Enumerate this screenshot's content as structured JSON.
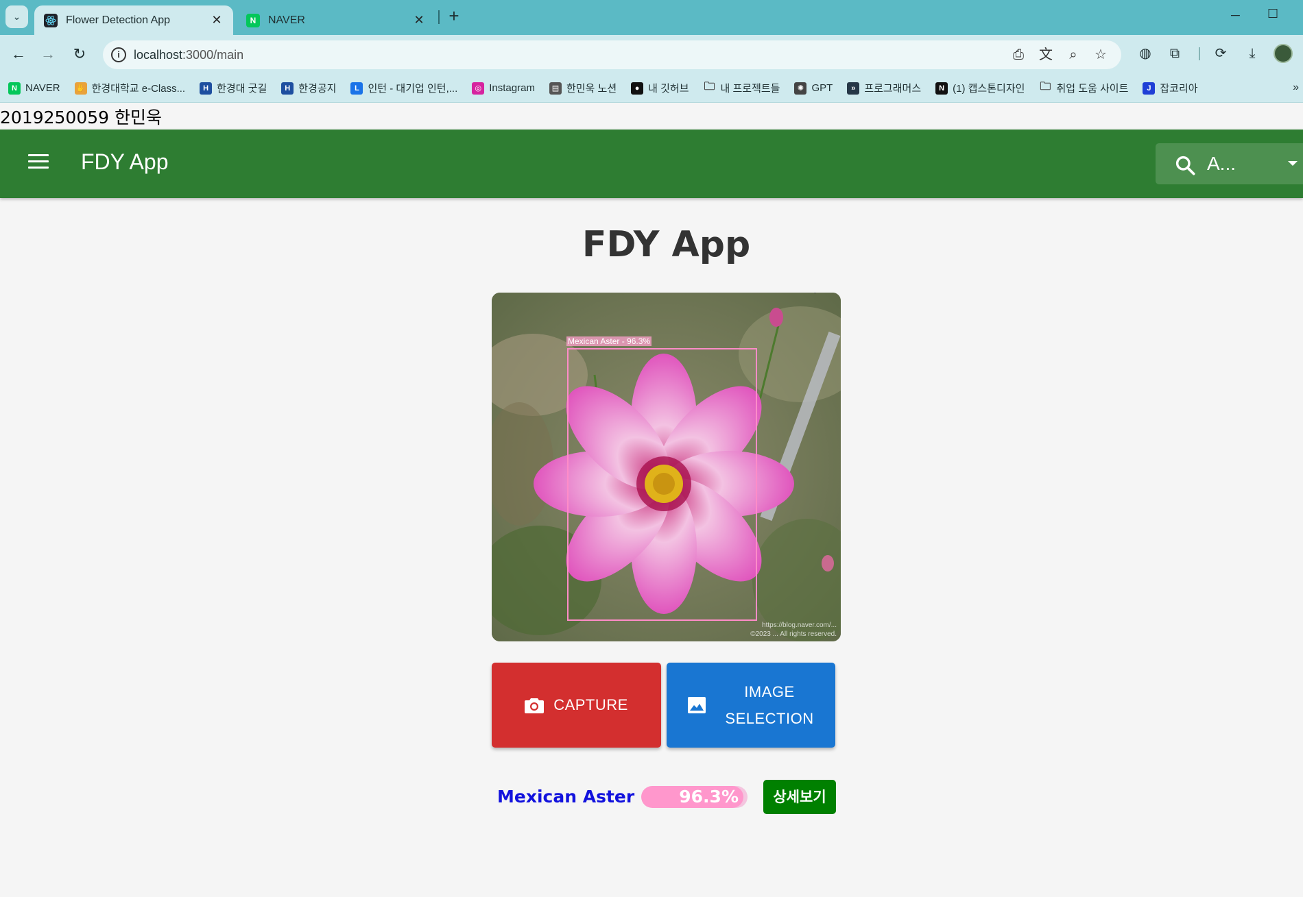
{
  "browser": {
    "tabs": [
      {
        "title": "Flower Detection App",
        "favicon": "react-icon",
        "active": true
      },
      {
        "title": "NAVER",
        "favicon": "naver-icon",
        "active": false
      }
    ],
    "new_tab_label": "+",
    "url_host": "localhost",
    "url_path": ":3000/main",
    "bookmarks": [
      {
        "label": "NAVER",
        "icon": "naver-icon",
        "color": "#03c75a"
      },
      {
        "label": "한경대학교 e-Class...",
        "icon": "hand-icon",
        "color": "#e9a23b"
      },
      {
        "label": "한경대 굿길",
        "icon": "hk-icon",
        "color": "#1e4fa0"
      },
      {
        "label": "한경공지",
        "icon": "hk-icon",
        "color": "#1e4fa0"
      },
      {
        "label": "인턴 - 대기업 인턴,...",
        "icon": "l-icon",
        "color": "#1a73e8"
      },
      {
        "label": "Instagram",
        "icon": "instagram-icon",
        "color": "#d6249f"
      },
      {
        "label": "한민욱 노션",
        "icon": "document-icon",
        "color": "#555555"
      },
      {
        "label": "내 깃허브",
        "icon": "github-icon",
        "color": "#111111"
      },
      {
        "label": "내 프로젝트들",
        "icon": "folder-icon",
        "color": "#444444"
      },
      {
        "label": "GPT",
        "icon": "openai-icon",
        "color": "#444444"
      },
      {
        "label": "프로그래머스",
        "icon": "programmers-icon",
        "color": "#263747"
      },
      {
        "label": "(1) 캡스톤디자인",
        "icon": "notion-icon",
        "color": "#111111"
      },
      {
        "label": "취업 도움 사이트",
        "icon": "folder-icon",
        "color": "#444444"
      },
      {
        "label": "잡코리아",
        "icon": "jobkorea-icon",
        "color": "#1f3fd6"
      }
    ]
  },
  "page": {
    "student_info": "2019250059 한민욱",
    "appbar_title": "FDY App",
    "search_value": "A...",
    "heading": "FDY App",
    "detection": {
      "label": "Mexican Aster - 96.3%",
      "watermark_line1": "https://blog.naver.com/...",
      "watermark_line2": "©2023 ... All rights reserved."
    },
    "capture_label": "CAPTURE",
    "image_selection_label": "IMAGE SELECTION",
    "result": {
      "flower_name": "Mexican Aster",
      "confidence_text": "96.3%",
      "confidence_value": 0.963,
      "detail_button": "상세보기"
    }
  },
  "colors": {
    "appbar": "#2e7d32",
    "capture": "#d32f2f",
    "image_selection": "#1976d2",
    "detail_button": "#008000",
    "result_name": "#1212dd",
    "confidence_fill": "#ff97cc",
    "detection_box": "#ff8cc8"
  }
}
